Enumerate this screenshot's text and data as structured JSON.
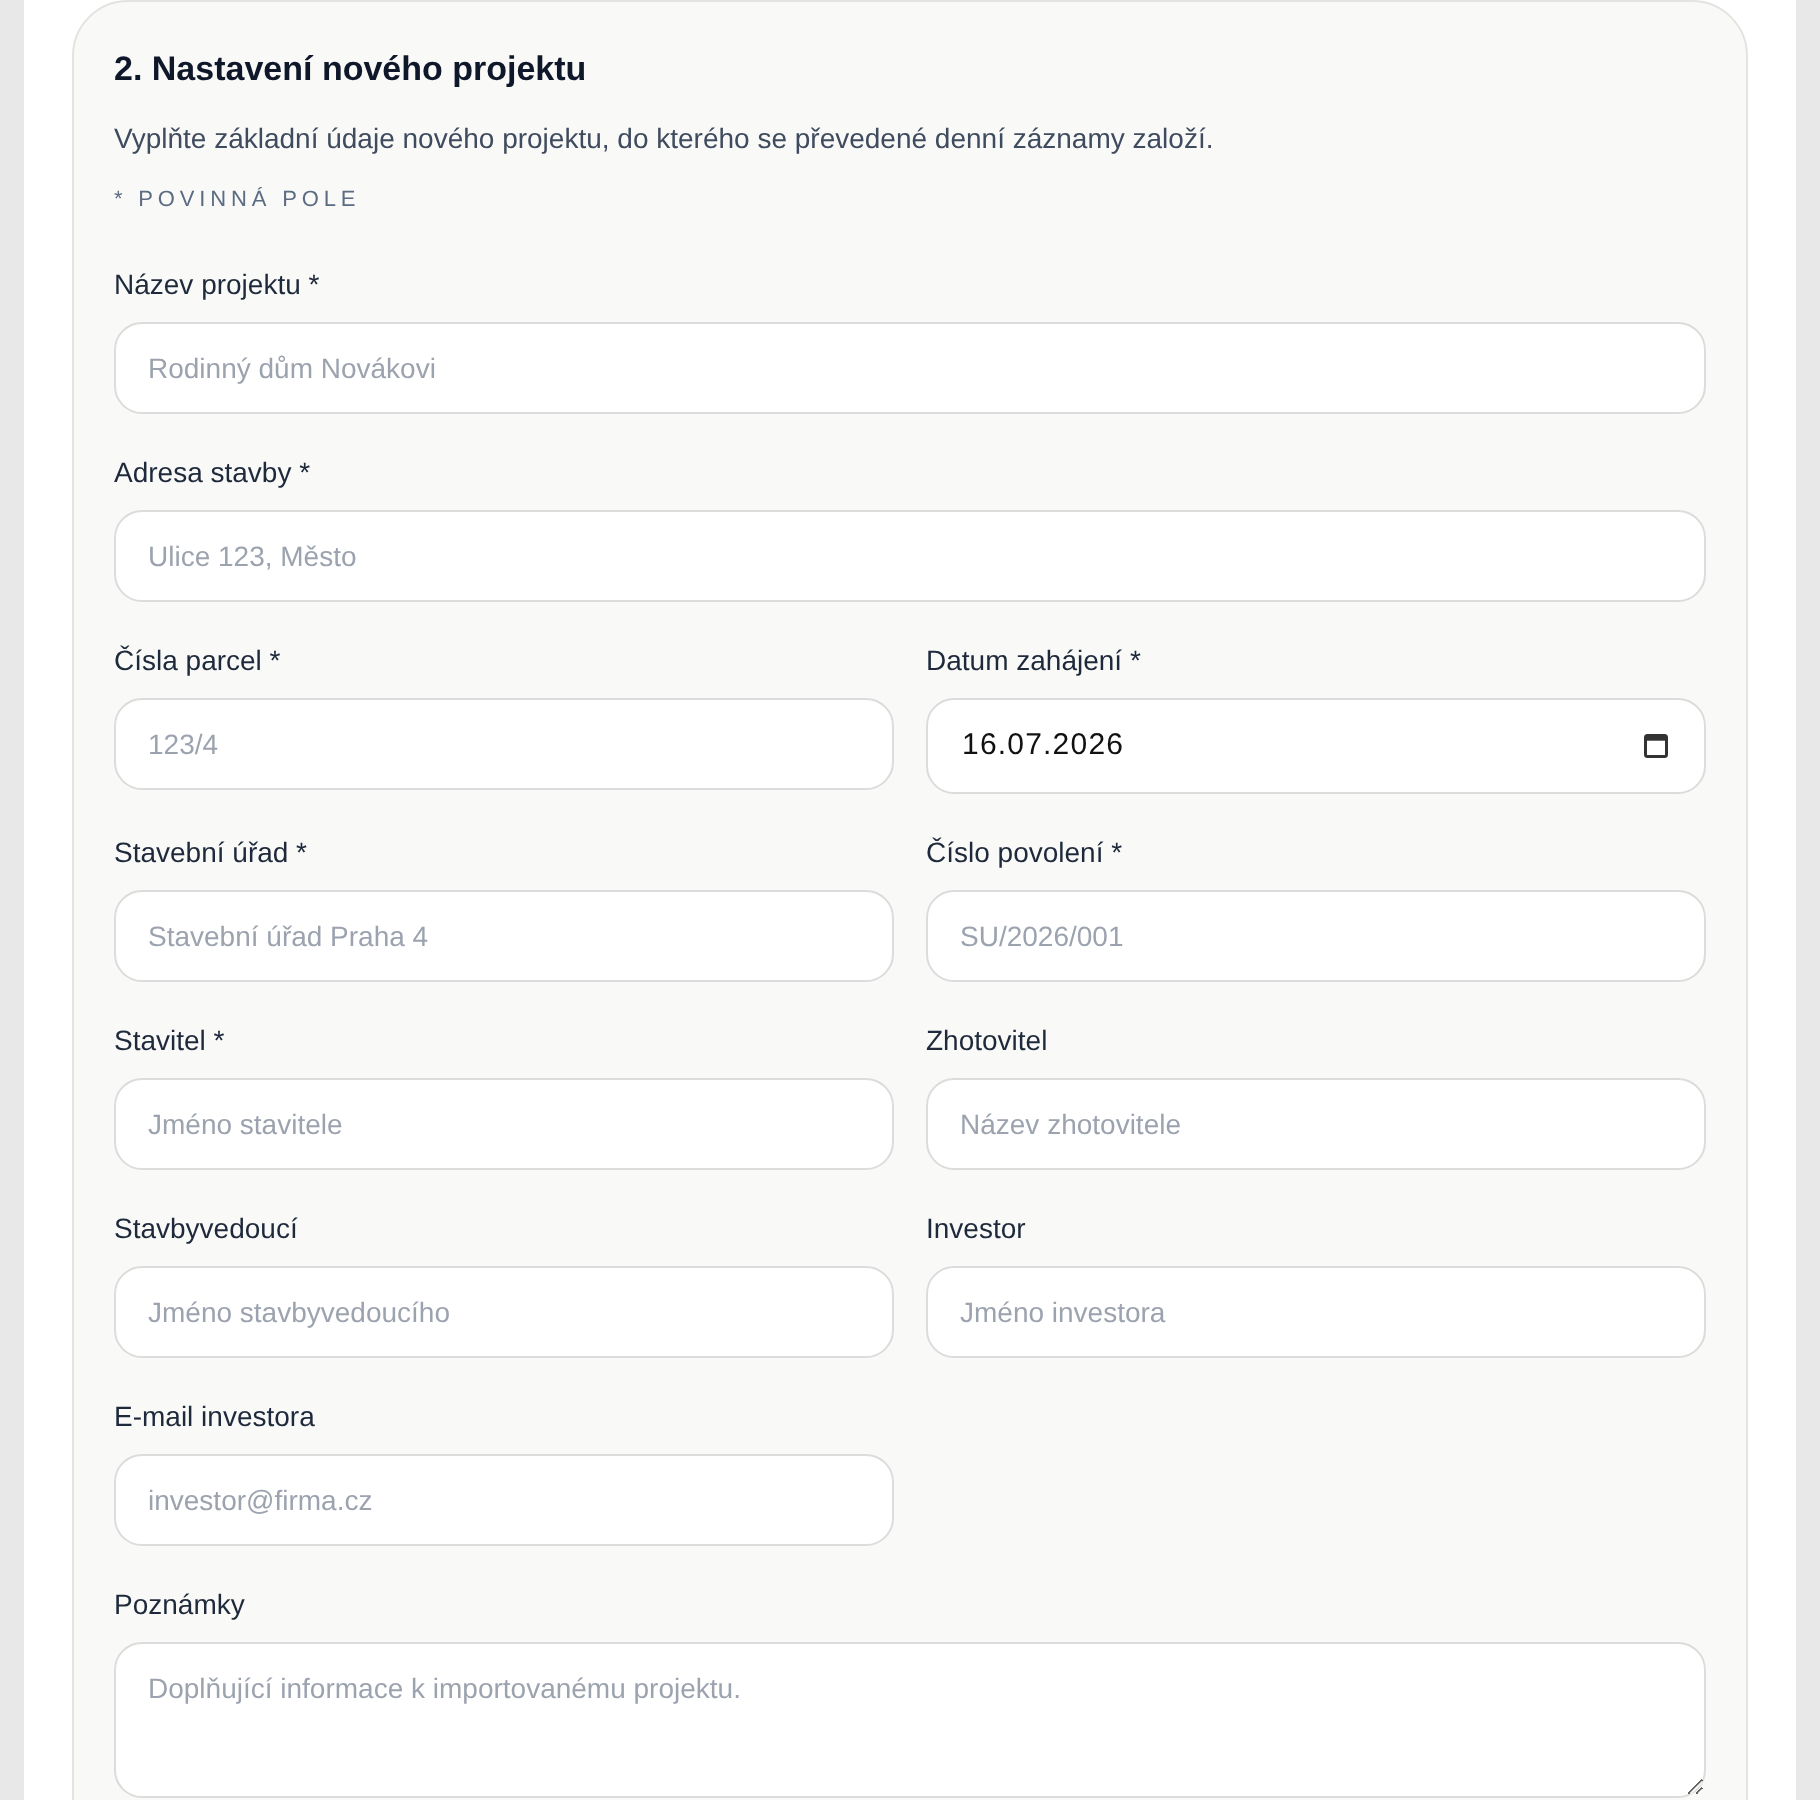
{
  "section": {
    "title": "2. Nastavení nového projektu",
    "description": "Vyplňte základní údaje nového projektu, do kterého se převedené denní záznamy založí.",
    "required_note": "* POVINNÁ POLE"
  },
  "rows": [
    {
      "kind": "wide",
      "fields": [
        {
          "kind": "text",
          "label": "Název projektu *",
          "placeholder": "Rodinný dům Novákovi"
        }
      ]
    },
    {
      "kind": "wide",
      "fields": [
        {
          "kind": "text",
          "label": "Adresa stavby *",
          "placeholder": "Ulice 123, Město"
        }
      ]
    },
    {
      "kind": "pair",
      "fields": [
        {
          "kind": "text",
          "label": "Čísla parcel *",
          "placeholder": "123/4"
        },
        {
          "kind": "date",
          "label": "Datum zahájení *",
          "value": "16.07.2026"
        }
      ]
    },
    {
      "kind": "pair",
      "fields": [
        {
          "kind": "text",
          "label": "Stavební úřad *",
          "placeholder": "Stavební úřad Praha 4"
        },
        {
          "kind": "text",
          "label": "Číslo povolení *",
          "placeholder": "SU/2026/001"
        }
      ]
    },
    {
      "kind": "pair",
      "fields": [
        {
          "kind": "text",
          "label": "Stavitel *",
          "placeholder": "Jméno stavitele"
        },
        {
          "kind": "text",
          "label": "Zhotovitel",
          "placeholder": "Název zhotovitele"
        }
      ]
    },
    {
      "kind": "pair",
      "fields": [
        {
          "kind": "text",
          "label": "Stavbyvedoucí",
          "placeholder": "Jméno stavbyvedoucího"
        },
        {
          "kind": "text",
          "label": "Investor",
          "placeholder": "Jméno investora"
        }
      ]
    },
    {
      "kind": "pair",
      "fields": [
        {
          "kind": "email",
          "label": "E-mail investora",
          "placeholder": "investor@firma.cz"
        }
      ]
    },
    {
      "kind": "wide",
      "fields": [
        {
          "kind": "textarea",
          "label": "Poznámky",
          "placeholder": "Doplňující informace k importovanému projektu."
        }
      ]
    }
  ]
}
